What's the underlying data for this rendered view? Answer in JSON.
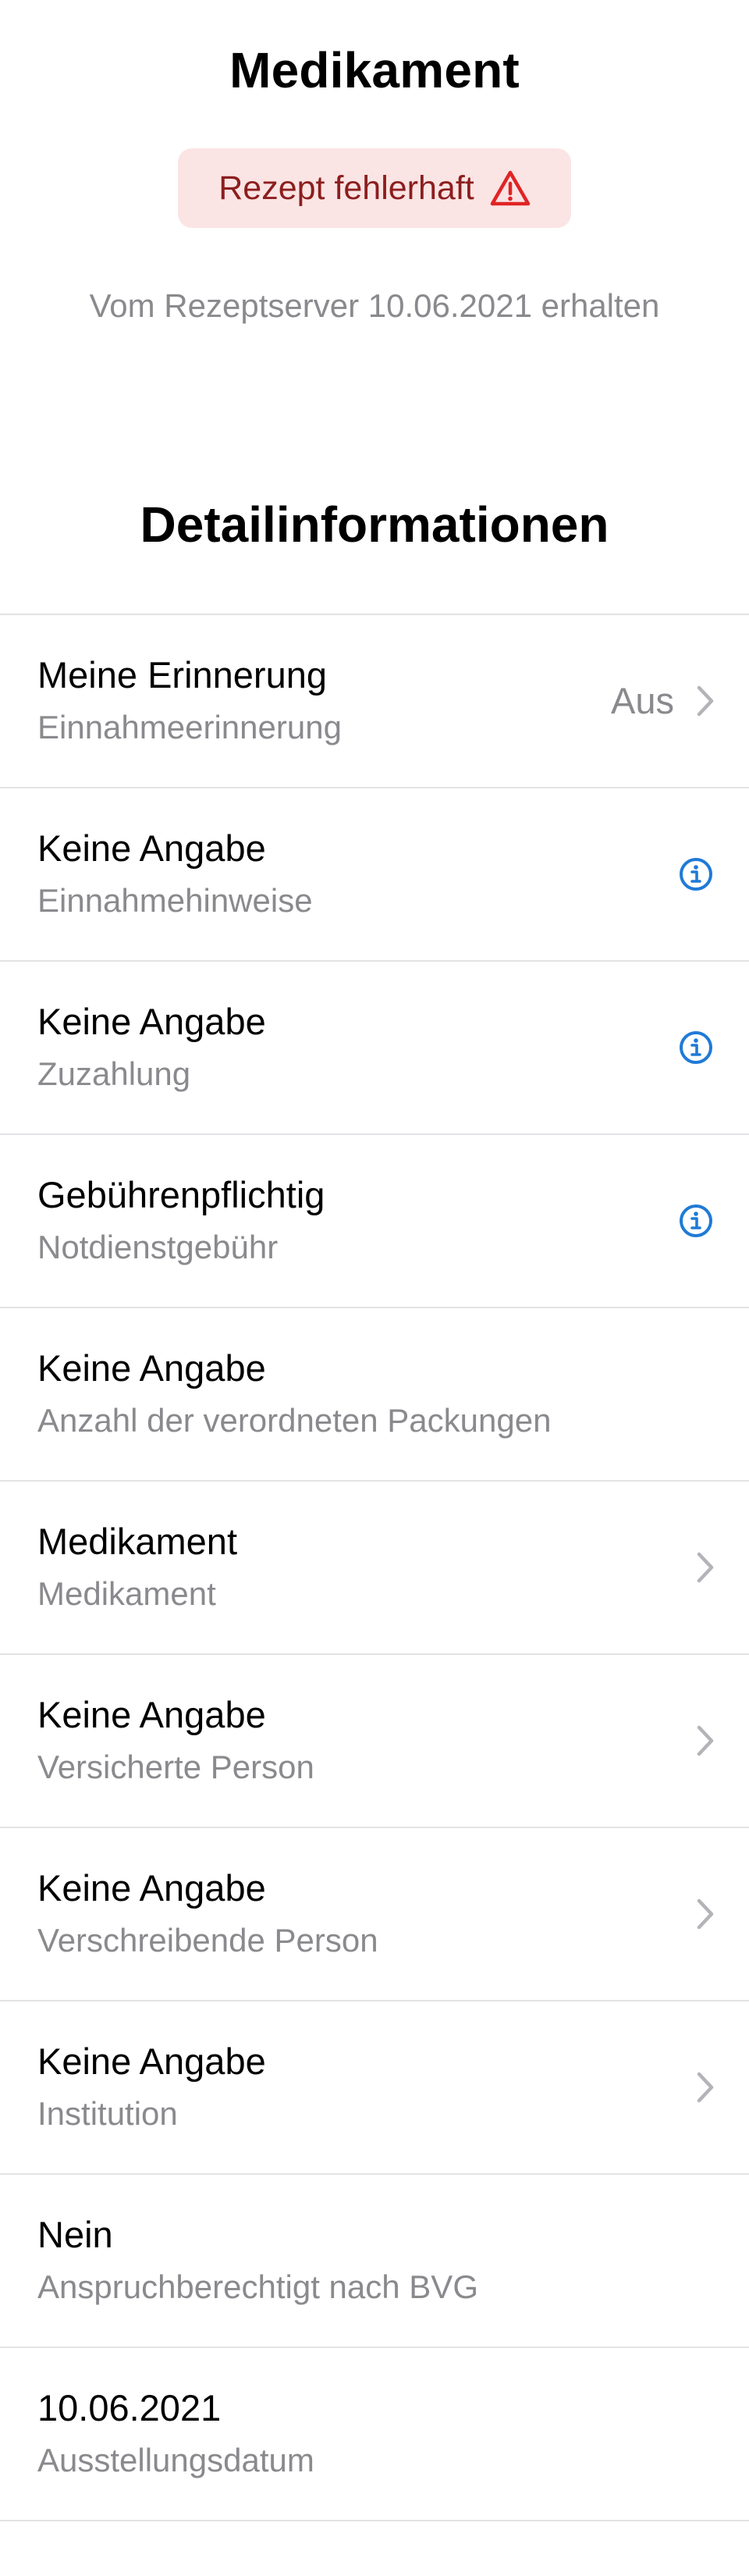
{
  "header": {
    "title": "Medikament",
    "status_badge": {
      "label": "Rezept fehlerhaft",
      "icon": "warning-triangle-icon",
      "background_color": "#fbe4e4",
      "text_color": "#8c1e1e",
      "icon_color": "#e02424"
    },
    "received_text": "Vom Rezeptserver 10.06.2021 erhalten"
  },
  "details": {
    "title": "Detailinformationen",
    "accent_color": "#1f7ad6",
    "rows": [
      {
        "value": "Meine Erinnerung",
        "label": "Einnahmeerinnerung",
        "trailing_text": "Aus",
        "trailing_icon": "chevron-right-icon"
      },
      {
        "value": "Keine Angabe",
        "label": "Einnahmehinweise",
        "trailing_icon": "info-icon"
      },
      {
        "value": "Keine Angabe",
        "label": "Zuzahlung",
        "trailing_icon": "info-icon"
      },
      {
        "value": "Gebührenpflichtig",
        "label": "Notdienstgebühr",
        "trailing_icon": "info-icon"
      },
      {
        "value": "Keine Angabe",
        "label": "Anzahl der verordneten Packungen"
      },
      {
        "value": "Medikament",
        "label": "Medikament",
        "trailing_icon": "chevron-right-icon"
      },
      {
        "value": "Keine Angabe",
        "label": "Versicherte Person",
        "trailing_icon": "chevron-right-icon"
      },
      {
        "value": "Keine Angabe",
        "label": "Verschreibende Person",
        "trailing_icon": "chevron-right-icon"
      },
      {
        "value": "Keine Angabe",
        "label": "Institution",
        "trailing_icon": "chevron-right-icon"
      },
      {
        "value": "Nein",
        "label": "Anspruchberechtigt nach BVG"
      },
      {
        "value": "10.06.2021",
        "label": "Ausstellungsdatum"
      }
    ]
  }
}
